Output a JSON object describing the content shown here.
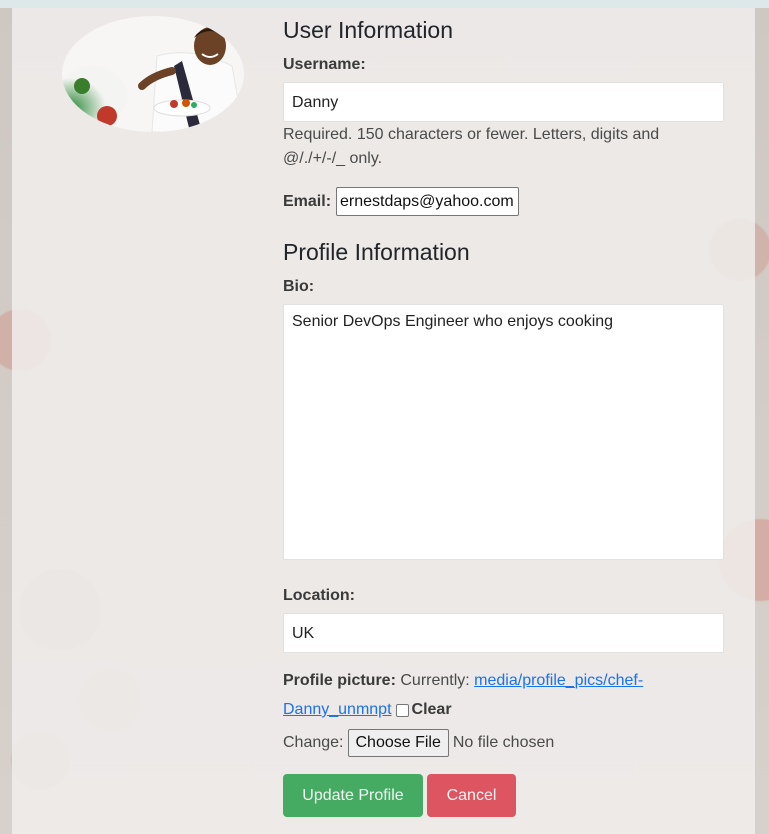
{
  "user_section": {
    "heading": "User Information",
    "username_label": "Username:",
    "username_value": "Danny",
    "username_help": "Required. 150 characters or fewer. Letters, digits and @/./+/-/_ only.",
    "email_label": "Email:",
    "email_value": "ernestdaps@yahoo.com"
  },
  "profile_section": {
    "heading": "Profile Information",
    "bio_label": "Bio:",
    "bio_value": "Senior DevOps Engineer who enjoys cooking",
    "location_label": "Location:",
    "location_value": "UK",
    "picture_label": "Profile picture:",
    "picture_currently": "Currently:",
    "picture_link_part1": "media/profile_pics/chef-",
    "picture_link_part2": "Danny_unmnpt",
    "clear_label": "Clear",
    "change_label": "Change:",
    "choose_file_label": "Choose File",
    "no_file_text": "No file chosen"
  },
  "actions": {
    "update_label": "Update Profile",
    "cancel_label": "Cancel"
  },
  "colors": {
    "update_button": "#45ab62",
    "cancel_button": "#dc5560",
    "link": "#1a73e8"
  },
  "avatar": {
    "icon": "chef-profile-photo"
  }
}
